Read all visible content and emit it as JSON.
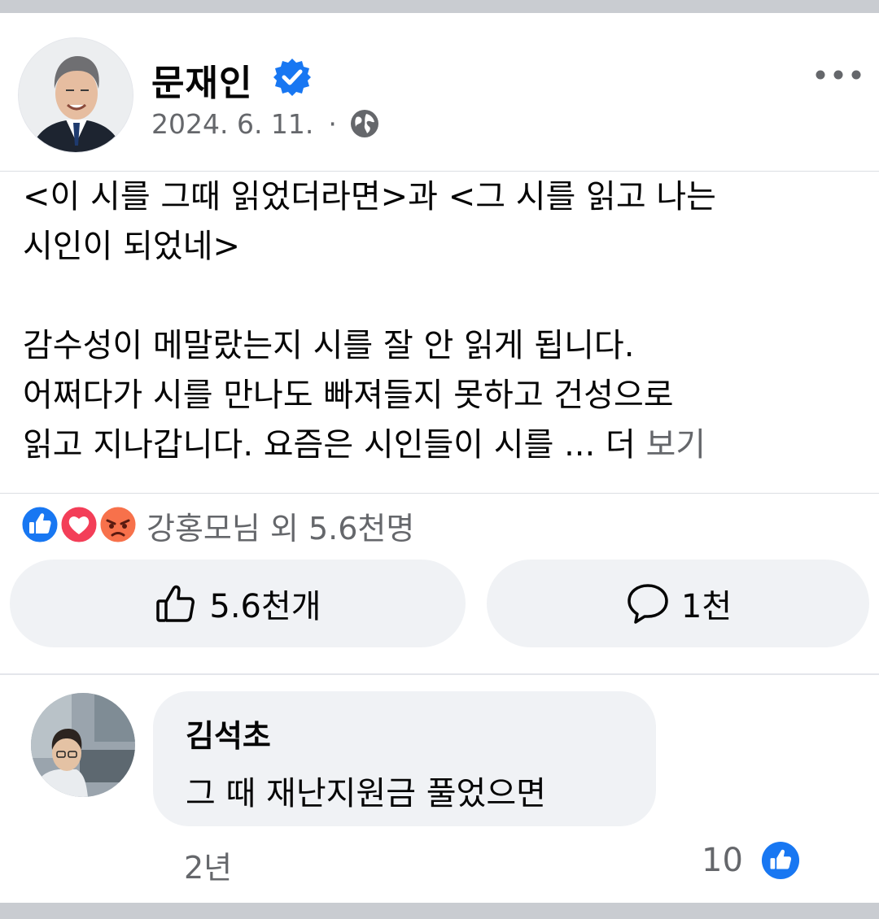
{
  "post": {
    "author": "문재인",
    "date": "2024. 6. 11.",
    "meta_separator": "·",
    "privacy_icon": "globe-icon",
    "verified_icon": "verified-badge-icon",
    "more_icon": "more-options-icon",
    "body": {
      "line1": "<이 시를 그때 읽었더라면>과 <그 시를 읽고 나는",
      "line2": "시인이 되었네>",
      "line3": "감수성이 메말랐는지 시를 잘 안 읽게 됩니다.",
      "line4": "어쩌다가 시를 만나도 빠져들지 못하고 건성으로",
      "line5": "읽고 지나갑니다. 요즘은 시인들이 시를 ... 더 ",
      "see_more": "보기"
    }
  },
  "reactions": {
    "icons": [
      "like-reaction-icon",
      "love-reaction-icon",
      "angry-reaction-icon"
    ],
    "summary": "강홍모님 외 5.6천명"
  },
  "actions": {
    "like_label": "5.6천개",
    "comment_label": "1천"
  },
  "comment": {
    "author": "김석초",
    "text": "그 때 재난지원금 풀었으면",
    "time": "2년",
    "likes": "10"
  },
  "colors": {
    "facebook_blue": "#1877f2",
    "love_red": "#f33e58",
    "angry_orange": "#f7714b",
    "secondary_text": "#65676b",
    "bubble_bg": "#f0f2f5"
  }
}
